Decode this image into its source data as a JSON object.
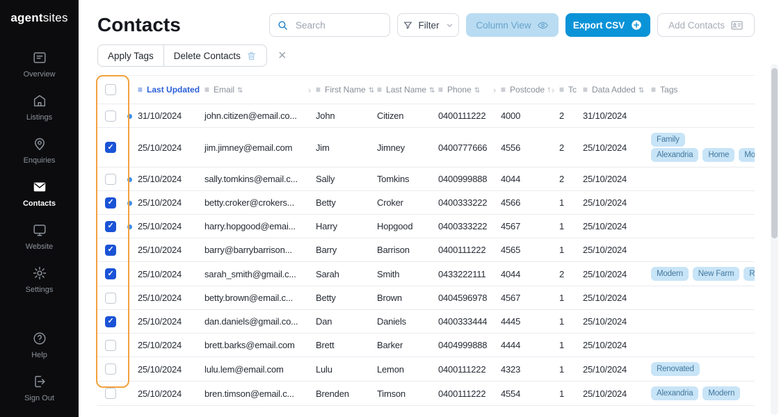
{
  "brand": {
    "name_primary": "agent",
    "name_secondary": "sites"
  },
  "sidebar": {
    "items": [
      {
        "id": "overview",
        "label": "Overview",
        "active": false
      },
      {
        "id": "listings",
        "label": "Listings",
        "active": false
      },
      {
        "id": "enquiries",
        "label": "Enquiries",
        "active": false
      },
      {
        "id": "contacts",
        "label": "Contacts",
        "active": true
      },
      {
        "id": "website",
        "label": "Website",
        "active": false
      },
      {
        "id": "settings",
        "label": "Settings",
        "active": false
      }
    ],
    "footer": [
      {
        "id": "help",
        "label": "Help"
      },
      {
        "id": "signout",
        "label": "Sign Out"
      }
    ]
  },
  "header": {
    "title": "Contacts",
    "search_placeholder": "Search",
    "filter": "Filter",
    "column_view": "Column View",
    "export_csv": "Export CSV",
    "add_contacts": "Add Contacts"
  },
  "toolbar": {
    "apply_tags": "Apply Tags",
    "delete_contacts": "Delete Contacts"
  },
  "table": {
    "columns": [
      {
        "id": "last_updated",
        "label": "Last Updated",
        "sortable": true,
        "active": true,
        "collapsed_after": false
      },
      {
        "id": "email",
        "label": "Email",
        "sortable": true,
        "active": false,
        "collapsed_after": true
      },
      {
        "id": "first_name",
        "label": "First Name",
        "sortable": true,
        "active": false,
        "collapsed_after": false
      },
      {
        "id": "last_name",
        "label": "Last Name",
        "sortable": true,
        "active": false,
        "collapsed_after": false
      },
      {
        "id": "phone",
        "label": "Phone",
        "sortable": true,
        "active": false,
        "collapsed_after": true
      },
      {
        "id": "postcode",
        "label": "Postcode",
        "sortable": true,
        "active": false,
        "collapsed_after": true
      },
      {
        "id": "tc",
        "label": "Tc",
        "sortable": false,
        "active": false,
        "collapsed_after": false
      },
      {
        "id": "data_added",
        "label": "Data Added",
        "sortable": true,
        "active": false,
        "collapsed_after": false
      },
      {
        "id": "tags",
        "label": "Tags",
        "sortable": false,
        "active": false,
        "collapsed_after": false
      }
    ],
    "rows": [
      {
        "selected": false,
        "unread": true,
        "last_updated": "31/10/2024",
        "email": "john.citizen@email.co...",
        "first_name": "John",
        "last_name": "Citizen",
        "phone": "0400111222",
        "postcode": "4000",
        "tc": "2",
        "data_added": "31/10/2024",
        "tag_lines": []
      },
      {
        "selected": true,
        "unread": false,
        "last_updated": "25/10/2024",
        "email": "jim.jimney@email.com",
        "first_name": "Jim",
        "last_name": "Jimney",
        "phone": "0400777666",
        "postcode": "4556",
        "tc": "2",
        "data_added": "25/10/2024",
        "tag_lines": [
          [
            "Family"
          ],
          [
            "Alexandria",
            "Home",
            "Modern"
          ]
        ]
      },
      {
        "selected": false,
        "unread": true,
        "last_updated": "25/10/2024",
        "email": "sally.tomkins@email.c...",
        "first_name": "Sally",
        "last_name": "Tomkins",
        "phone": "0400999888",
        "postcode": "4044",
        "tc": "2",
        "data_added": "25/10/2024",
        "tag_lines": []
      },
      {
        "selected": true,
        "unread": true,
        "last_updated": "25/10/2024",
        "email": "betty.croker@crokers...",
        "first_name": "Betty",
        "last_name": "Croker",
        "phone": "0400333222",
        "postcode": "4566",
        "tc": "1",
        "data_added": "25/10/2024",
        "tag_lines": []
      },
      {
        "selected": true,
        "unread": true,
        "last_updated": "25/10/2024",
        "email": "harry.hopgood@emai...",
        "first_name": "Harry",
        "last_name": "Hopgood",
        "phone": "0400333222",
        "postcode": "4567",
        "tc": "1",
        "data_added": "25/10/2024",
        "tag_lines": []
      },
      {
        "selected": true,
        "unread": false,
        "last_updated": "25/10/2024",
        "email": "barry@barrybarrison...",
        "first_name": "Barry",
        "last_name": "Barrison",
        "phone": "0400111222",
        "postcode": "4565",
        "tc": "1",
        "data_added": "25/10/2024",
        "tag_lines": []
      },
      {
        "selected": true,
        "unread": false,
        "last_updated": "25/10/2024",
        "email": "sarah_smith@gmail.c...",
        "first_name": "Sarah",
        "last_name": "Smith",
        "phone": "0433222111",
        "postcode": "4044",
        "tc": "2",
        "data_added": "25/10/2024",
        "tag_lines": [
          [
            "Modern",
            "New Farm",
            "Renovated"
          ]
        ]
      },
      {
        "selected": false,
        "unread": false,
        "last_updated": "25/10/2024",
        "email": "betty.brown@email.c...",
        "first_name": "Betty",
        "last_name": "Brown",
        "phone": "0404596978",
        "postcode": "4567",
        "tc": "1",
        "data_added": "25/10/2024",
        "tag_lines": []
      },
      {
        "selected": true,
        "unread": false,
        "last_updated": "25/10/2024",
        "email": "dan.daniels@gmail.co...",
        "first_name": "Dan",
        "last_name": "Daniels",
        "phone": "0400333444",
        "postcode": "4445",
        "tc": "1",
        "data_added": "25/10/2024",
        "tag_lines": []
      },
      {
        "selected": false,
        "unread": false,
        "last_updated": "25/10/2024",
        "email": "brett.barks@email.com",
        "first_name": "Brett",
        "last_name": "Barker",
        "phone": "0404999888",
        "postcode": "4444",
        "tc": "1",
        "data_added": "25/10/2024",
        "tag_lines": []
      },
      {
        "selected": false,
        "unread": false,
        "last_updated": "25/10/2024",
        "email": "lulu.lem@email.com",
        "first_name": "Lulu",
        "last_name": "Lemon",
        "phone": "0400111222",
        "postcode": "4323",
        "tc": "1",
        "data_added": "25/10/2024",
        "tag_lines": [
          [
            "Renovated"
          ]
        ]
      },
      {
        "selected": false,
        "unread": false,
        "last_updated": "25/10/2024",
        "email": "bren.timson@email.c...",
        "first_name": "Brenden",
        "last_name": "Timson",
        "phone": "0400111222",
        "postcode": "4554",
        "tc": "1",
        "data_added": "25/10/2024",
        "tag_lines": [
          [
            "Alexandria",
            "Modern"
          ]
        ]
      }
    ]
  },
  "colors": {
    "accent_blue": "#0b93d8",
    "column_view_bg": "#b9dcf2",
    "tag_bg": "#c8e4f7",
    "tag_text": "#41789f",
    "highlight_orange": "#f2a13c",
    "checkbox_checked": "#1a53d6",
    "unread_dot": "#3e8ee8",
    "sorted_header": "#2a5fd7",
    "sidebar_bg": "#0c0c0e"
  }
}
